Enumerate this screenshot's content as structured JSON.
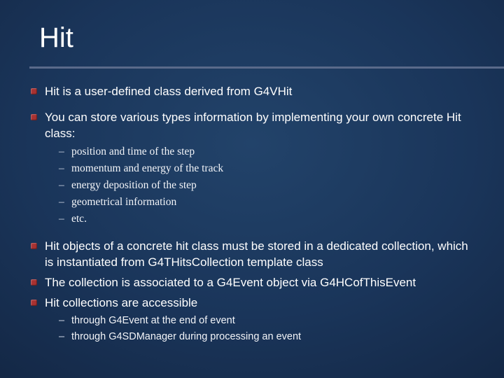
{
  "title": "Hit",
  "bullets": {
    "b1": "Hit is a user-defined class derived from G4VHit",
    "b2": "You can store various types information by implementing your own concrete Hit class:",
    "b2_items": {
      "i1": "position and time of the step",
      "i2": "momentum and energy of the track",
      "i3": "energy deposition of the step",
      "i4": "geometrical information",
      "i5": "etc."
    },
    "b3": "Hit objects of a concrete hit class must be stored in a dedicated collection, which is instantiated from G4THitsCollection template class",
    "b4": "The collection is associated to a G4Event object via G4HCofThisEvent",
    "b5": "Hit collections are accessible",
    "b5_items": {
      "i1": "through G4Event at the end of event",
      "i2": "through G4SDManager during processing an event"
    }
  }
}
